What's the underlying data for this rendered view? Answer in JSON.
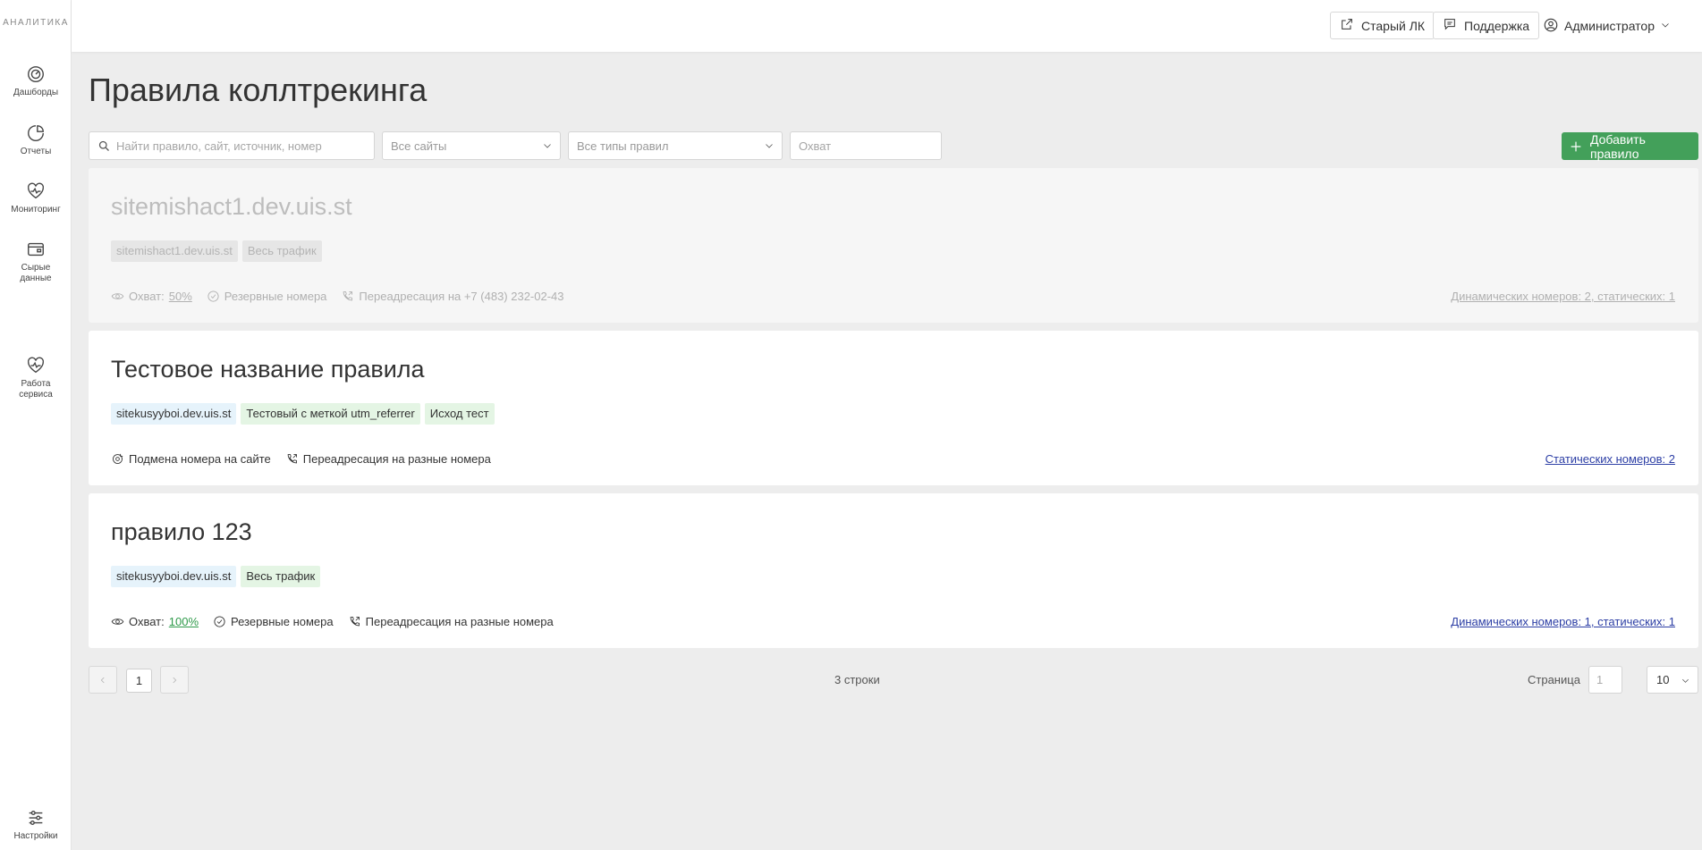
{
  "brand": "АНАЛИТИКА",
  "sidebar": {
    "items": [
      {
        "label": "Дашборды",
        "icon": "dashboard-gauge-icon"
      },
      {
        "label": "Отчеты",
        "icon": "pie-chart-icon"
      },
      {
        "label": "Мониторинг",
        "icon": "heart-pulse-icon"
      },
      {
        "label": "Сырые данные",
        "icon": "wallet-icon"
      },
      {
        "label": "Работа сервиса",
        "icon": "heart-pulse-icon"
      }
    ],
    "settings_label": "Настройки"
  },
  "header": {
    "old_lk": "Старый ЛК",
    "support": "Поддержка",
    "user": "Администратор"
  },
  "page": {
    "title": "Правила коллтрекинга"
  },
  "filters": {
    "search_placeholder": "Найти правило, сайт, источник, номер",
    "sites": "Все сайты",
    "rule_types": "Все типы правил",
    "coverage_placeholder": "Охват",
    "add_button": "Добавить правило"
  },
  "rules": [
    {
      "name": "sitemishact1.dev.uis.st",
      "disabled": true,
      "tags": [
        {
          "text": "sitemishact1.dev.uis.st",
          "kind": "site"
        },
        {
          "text": "Весь трафик",
          "kind": "src"
        }
      ],
      "coverage_label": "Охват:",
      "coverage_value": "50%",
      "reserve": "Резервные номера",
      "forward": "Переадресация на +7 (483) 232-02-43",
      "numbers": "Динамических номеров: 2, статических: 1"
    },
    {
      "name": "Тестовое название правила",
      "disabled": false,
      "tags": [
        {
          "text": "sitekusyyboi.dev.uis.st",
          "kind": "site"
        },
        {
          "text": "Тестовый с меткой utm_referrer",
          "kind": "src"
        },
        {
          "text": "Исход тест",
          "kind": "src"
        }
      ],
      "substitution": "Подмена номера на сайте",
      "forward": "Переадресация на разные номера",
      "numbers": "Статических номеров: 2"
    },
    {
      "name": "правило 123",
      "disabled": false,
      "tags": [
        {
          "text": "sitekusyyboi.dev.uis.st",
          "kind": "site"
        },
        {
          "text": "Весь трафик",
          "kind": "src"
        }
      ],
      "coverage_label": "Охват:",
      "coverage_value": "100%",
      "reserve": "Резервные номера",
      "forward": "Переадресация на разные номера",
      "numbers": "Динамических номеров: 1, статических: 1"
    }
  ],
  "pagination": {
    "current": "1",
    "rows": "3 строки",
    "page_label": "Страница",
    "page_input_placeholder": "1",
    "per_page": "10"
  },
  "colors": {
    "accent_green": "#43a05a",
    "link_blue": "#2c3ea5",
    "tag_site": "#e6f3fb",
    "tag_src": "#e4f5e4"
  }
}
